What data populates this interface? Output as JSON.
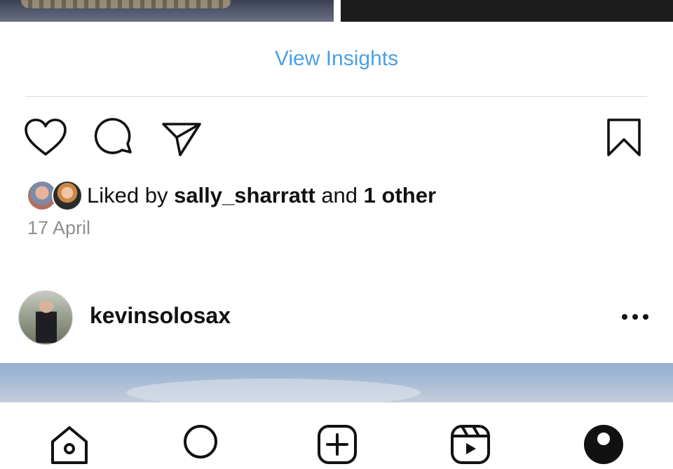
{
  "post_above": {
    "insights_label": "View Insights",
    "liked_by_prefix": "Liked by ",
    "liked_by_user": "sally_sharratt",
    "liked_by_conjunction": " and ",
    "liked_by_others": "1 other",
    "date": "17 April",
    "icons": [
      "heart-icon",
      "comment-icon",
      "share-icon",
      "bookmark-icon"
    ]
  },
  "post_next": {
    "username": "kevinsolosax",
    "more_icon": "more-icon"
  },
  "tab_bar": {
    "tabs": [
      "home-icon",
      "search-icon",
      "create-icon",
      "reels-icon",
      "profile-icon"
    ]
  },
  "colors": {
    "link": "#4aa0e6",
    "secondary_text": "#8e8e8e",
    "divider": "#d9d9d9"
  }
}
